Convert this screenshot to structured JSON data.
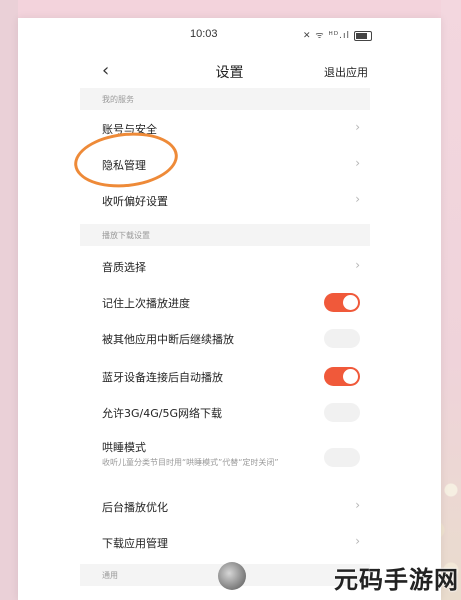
{
  "status_bar": {
    "time": "10:03",
    "icons": "✕ ᯤ ᴴᴰ.ıl"
  },
  "nav": {
    "back_icon": "chevron-left",
    "title": "设置",
    "exit_label": "退出应用"
  },
  "sections": {
    "my_services": "我的服务",
    "playback_download": "播放下载设置",
    "general": "通用"
  },
  "items": {
    "account_security": "账号与安全",
    "privacy": "隐私管理",
    "listening_prefs": "收听偏好设置",
    "audio_quality": "音质选择",
    "remember_progress": "记住上次播放进度",
    "resume_after_interrupt": "被其他应用中断后继续播放",
    "bluetooth_autoplay": "蓝牙设备连接后自动播放",
    "allow_mobile_download": "允许3G/4G/5G网络下载",
    "sleep_mode": "哄睡模式",
    "sleep_mode_desc": "收听儿童分类节目时用“哄睡模式”代替“定时关闭”",
    "background_optimize": "后台播放优化",
    "download_app_manage": "下载应用管理"
  },
  "toggles": {
    "remember_progress": true,
    "resume_after_interrupt": false,
    "bluetooth_autoplay": true,
    "allow_mobile_download": false,
    "sleep_mode": false
  },
  "colors": {
    "toggle_on": "#f0593a",
    "highlight_circle": "#ee8a38"
  },
  "watermark": "元码手游网"
}
